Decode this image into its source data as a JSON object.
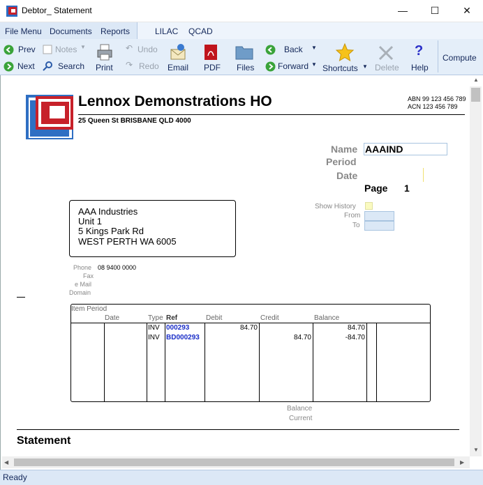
{
  "window": {
    "title": "Debtor_ Statement",
    "minimize": "—",
    "maximize": "☐",
    "close": "✕"
  },
  "menu": {
    "file": "File Menu",
    "documents": "Documents",
    "reports": "Reports",
    "lilac": "LILAC",
    "qcad": "QCAD"
  },
  "toolbar": {
    "prev": "Prev",
    "next": "Next",
    "notes": "Notes",
    "search": "Search",
    "undo": "Undo",
    "redo": "Redo",
    "print": "Print",
    "email": "Email",
    "pdf": "PDF",
    "files": "Files",
    "back": "Back",
    "forward": "Forward",
    "shortcuts": "Shortcuts",
    "delete": "Delete",
    "help": "Help",
    "compute": "Compute"
  },
  "company": {
    "name": "Lennox Demonstrations HO",
    "address": "25 Queen St BRISBANE QLD 4000",
    "abn": "ABN 99 123 456 789",
    "acn": "ACN 123 456 789"
  },
  "header_fields": {
    "name_label": "Name",
    "name_value": "AAAIND",
    "period_label": "Period",
    "date_label": "Date",
    "page_label": "Page",
    "page_value": "1"
  },
  "history": {
    "show_label": "Show History",
    "from_label": "From",
    "to_label": "To"
  },
  "customer": {
    "line1": "AAA Industries",
    "line2": "Unit 1",
    "line3": "5 Kings Park Rd",
    "line4": "WEST PERTH WA 6005",
    "phone_label": "Phone",
    "phone_value": "08 9400 0000",
    "fax_label": "Fax",
    "email_label": "e Mail",
    "domain_label": "Domain"
  },
  "grid": {
    "headers": {
      "item_period": "Item Period",
      "date": "Date",
      "type": "Type",
      "ref": "Ref",
      "debit": "Debit",
      "credit": "Credit",
      "balance": "Balance"
    },
    "rows": [
      {
        "type": "INV",
        "ref": "000293",
        "debit": "84.70",
        "credit": "",
        "balance": "84.70"
      },
      {
        "type": "INV",
        "ref": "BD000293",
        "debit": "",
        "credit": "84.70",
        "balance": "-84.70"
      }
    ]
  },
  "footer": {
    "balance_label": "Balance",
    "current_label": "Current",
    "statement_heading": "Statement"
  },
  "status": {
    "text": "Ready"
  },
  "icons": [
    "app-icon",
    "prev-arrow-icon",
    "next-arrow-icon",
    "notes-icon",
    "search-icon",
    "undo-icon",
    "redo-icon",
    "print-icon",
    "email-icon",
    "pdf-icon",
    "files-icon",
    "back-icon",
    "forward-icon",
    "shortcuts-star-icon",
    "delete-icon",
    "help-icon",
    "company-logo"
  ]
}
